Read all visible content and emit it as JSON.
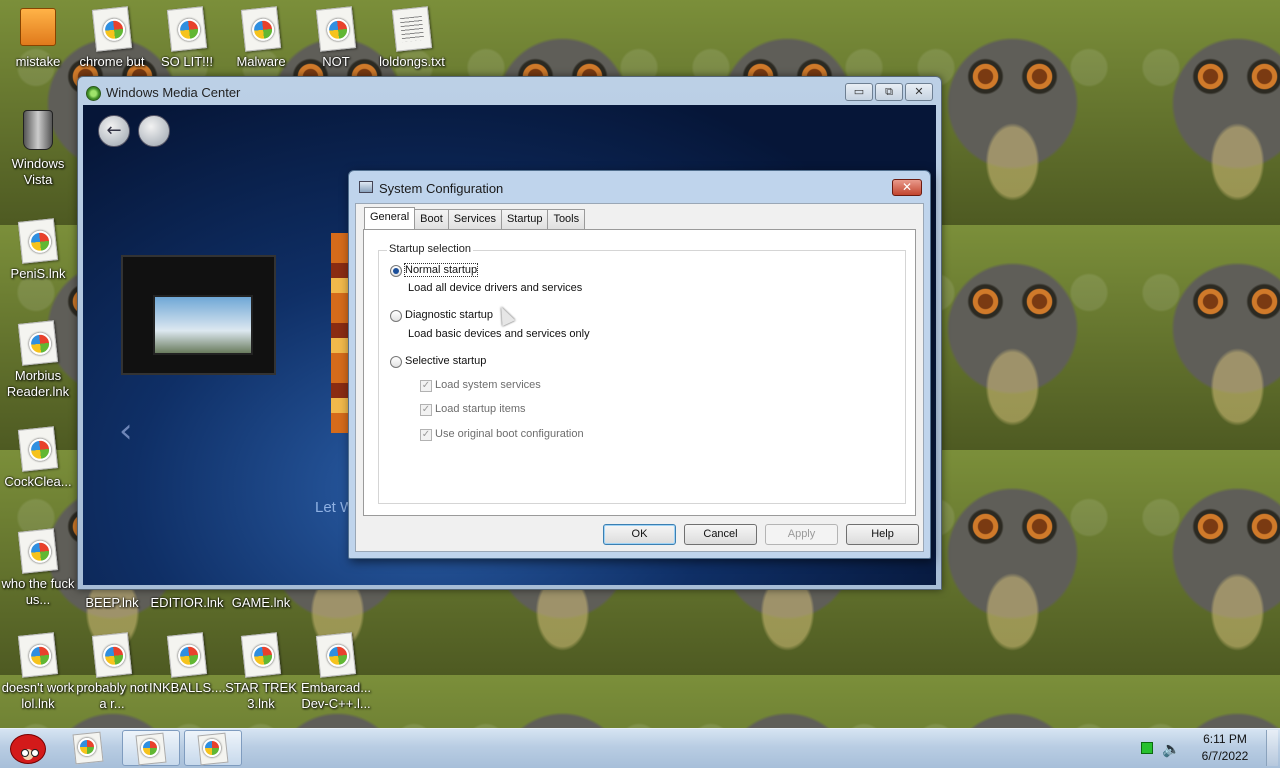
{
  "desktop": {
    "icons": [
      {
        "label": "mistake",
        "type": "setup"
      },
      {
        "label": "chrome but",
        "type": "doc"
      },
      {
        "label": "SO LIT!!!",
        "type": "doc"
      },
      {
        "label": "Malware",
        "type": "doc"
      },
      {
        "label": "NOT",
        "type": "doc"
      },
      {
        "label": "loldongs.txt",
        "type": "txt"
      },
      {
        "label": "Windows Vista",
        "type": "bin"
      },
      {
        "label": "PeniS.lnk",
        "type": "doc"
      },
      {
        "label": "Morbius Reader.lnk",
        "type": "doc"
      },
      {
        "label": "CockClea...",
        "type": "doc"
      },
      {
        "label": "who the fuck us...",
        "type": "doc"
      },
      {
        "label": "BEEP.lnk",
        "type": "doc"
      },
      {
        "label": "EDITIOR.lnk",
        "type": "doc"
      },
      {
        "label": "GAME.lnk",
        "type": "doc"
      },
      {
        "label": "doesn't work lol.lnk",
        "type": "doc"
      },
      {
        "label": "probably not a r...",
        "type": "doc"
      },
      {
        "label": "INKBALLS....",
        "type": "doc"
      },
      {
        "label": "STAR TREK 3.lnk",
        "type": "doc"
      },
      {
        "label": "Embarcad... Dev-C++.l...",
        "type": "doc"
      }
    ]
  },
  "media_center": {
    "title": "Windows Media Center",
    "minimize": "▭",
    "restore": "⧉",
    "close": "✕",
    "back_glyph": "←",
    "prev_glyph": "‹",
    "partial_text": "Let W"
  },
  "sysconfig": {
    "title": "System Configuration",
    "close_glyph": "✕",
    "tabs": [
      "General",
      "Boot",
      "Services",
      "Startup",
      "Tools"
    ],
    "active_tab": "General",
    "group_label": "Startup selection",
    "normal_label": "Normal startup",
    "normal_desc": "Load all device drivers and services",
    "diagnostic_label": "Diagnostic startup",
    "diagnostic_desc": "Load basic devices and services only",
    "selective_label": "Selective startup",
    "selected": "Normal startup",
    "checkboxes": [
      "Load system services",
      "Load startup items",
      "Use original boot configuration"
    ],
    "check_glyph": "✓",
    "buttons": {
      "ok": "OK",
      "cancel": "Cancel",
      "apply": "Apply",
      "help": "Help"
    }
  },
  "taskbar": {
    "tray_speaker": "🔈",
    "clock_time": "6:11 PM",
    "clock_date": "6/7/2022"
  }
}
